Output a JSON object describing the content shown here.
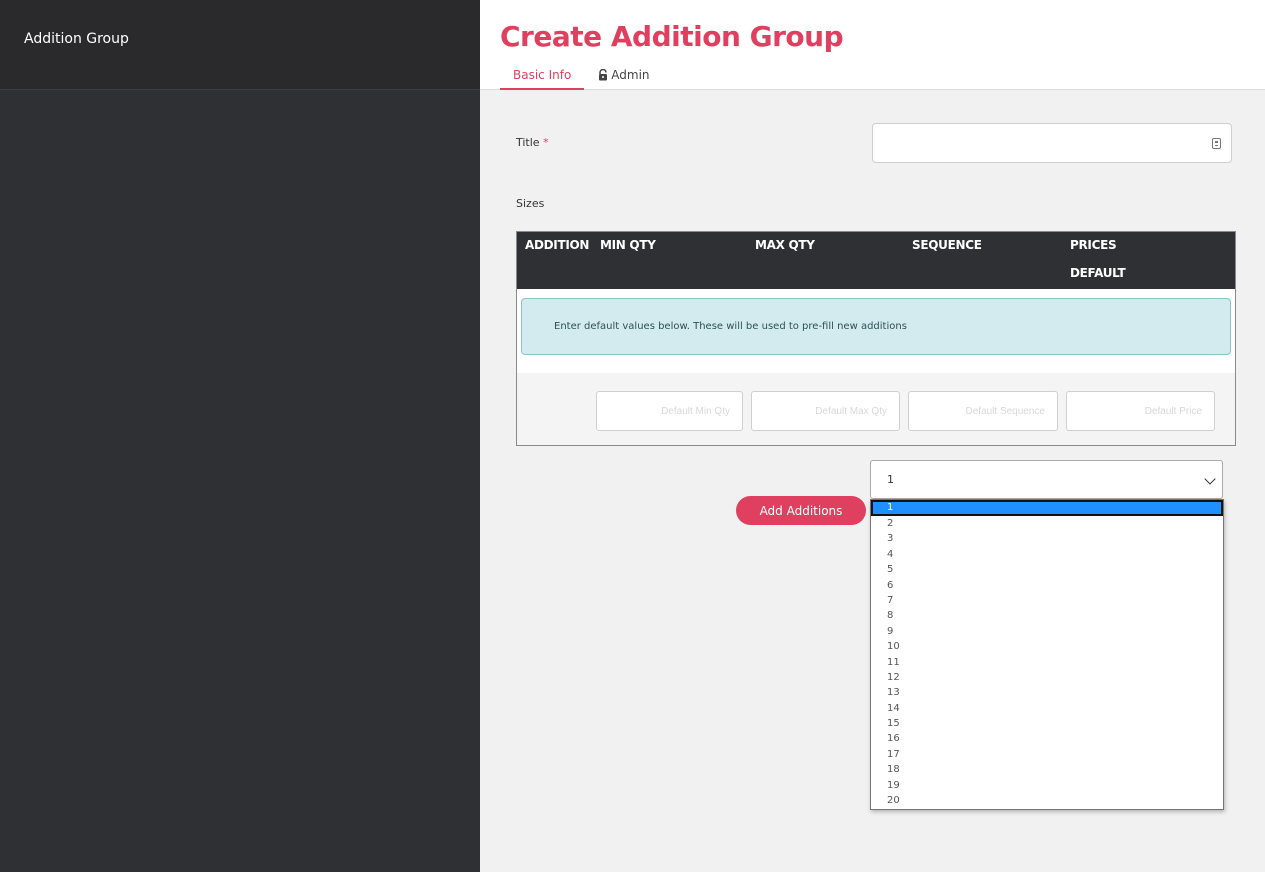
{
  "sidebar": {
    "title": "Addition Group"
  },
  "header": {
    "title": "Create Addition Group",
    "tabs": [
      {
        "label": "Basic Info",
        "active": true
      },
      {
        "label": "Admin",
        "icon": "lock-icon"
      }
    ]
  },
  "form": {
    "title_label": "Title",
    "required_mark": "*",
    "title_value": "",
    "sizes_label": "Sizes"
  },
  "table": {
    "headers": [
      "ADDITION",
      "MIN QTY",
      "MAX QTY",
      "SEQUENCE",
      "PRICES",
      "DEFAULT"
    ],
    "info_message": "Enter default values below. These will be used to pre-fill new additions",
    "placeholders": {
      "min_qty": "Default Min Qty",
      "max_qty": "Default Max Qty",
      "sequence": "Default Sequence",
      "price": "Default Price"
    }
  },
  "add_button": {
    "label": "Add Additions"
  },
  "quantity_select": {
    "selected": "1",
    "options": [
      "1",
      "2",
      "3",
      "4",
      "5",
      "6",
      "7",
      "8",
      "9",
      "10",
      "11",
      "12",
      "13",
      "14",
      "15",
      "16",
      "17",
      "18",
      "19",
      "20"
    ]
  },
  "colors": {
    "accent": "#e0405f",
    "sidebar": "#2f3033",
    "info_bg": "#d3eaee",
    "highlight": "#1e90ff"
  }
}
